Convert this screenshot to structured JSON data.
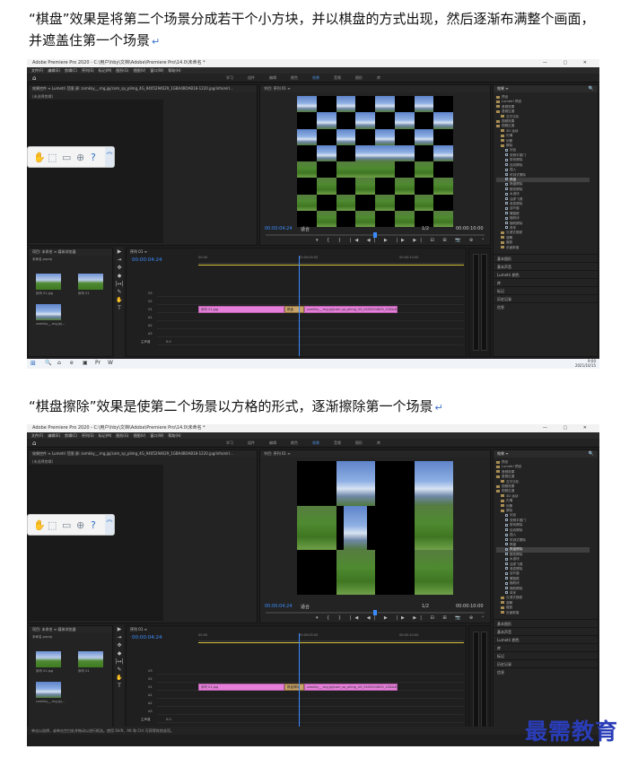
{
  "doc": {
    "para1": "“棋盘”效果是将第二个场景分成若干个小方块，并以棋盘的方式出现，然后逐渐布满整个画面，并遮盖住第一个场景",
    "para2": "“棋盘擦除”效果是使第二个场景以方格的形式，逐渐擦除第一个场景",
    "para_mark": "↵",
    "watermark": "最需教育"
  },
  "app": {
    "window_title": "Adobe Premiere Pro 2020 - C:\\用户\\hby\\文档\\Adobe\\Premiere Pro\\14.0\\未命名 *",
    "window_controls": "— ▢ ✕",
    "home_icon": "⌂",
    "menu": [
      "文件(F)",
      "编辑(E)",
      "剪辑(C)",
      "序列(S)",
      "标记(M)",
      "图形(G)",
      "视图(V)",
      "窗口(W)",
      "帮助(H)"
    ],
    "workspaces": [
      "学习",
      "组件",
      "编辑",
      "颜色",
      "效果",
      "音频",
      "图形",
      "库"
    ],
    "active_workspace": "效果",
    "source_panel": {
      "tabs": "效果控件 ≡   Lumetri 范围   源: zxmkky__.mg,jpj/com_sp_plimg_4G_9405294629_1GBA4BOAB18-1220.jpg/info/e/rl...",
      "no_clip": "(未选择剪辑)"
    },
    "program": {
      "title": "节目: 序列 01 ≡",
      "timecode": "00:00:04:24",
      "fit": "适合",
      "scale": "1/2",
      "duration": "00:00:10:00",
      "controls": "▾ { } |◀ ◀| ▶ |▶ ▶| ⊟ ⊞ 📷 ⊕ ⁺"
    },
    "effects": {
      "title": "效果 ≡",
      "search": "🔍",
      "tree": [
        {
          "label": "预设",
          "type": "fold",
          "indent": 0
        },
        {
          "label": "Lumetri 预设",
          "type": "fold",
          "indent": 0
        },
        {
          "label": "音频效果",
          "type": "fold",
          "indent": 0
        },
        {
          "label": "音频过渡",
          "type": "fold",
          "indent": 0
        },
        {
          "label": "交叉淡化",
          "type": "fold",
          "indent": 1
        },
        {
          "label": "视频效果",
          "type": "fold",
          "indent": 0
        },
        {
          "label": "视频过渡",
          "type": "fold",
          "indent": 0
        },
        {
          "label": "3D 运动",
          "type": "fold",
          "indent": 1
        },
        {
          "label": "内滑",
          "type": "fold",
          "indent": 1
        },
        {
          "label": "划像",
          "type": "fold",
          "indent": 1
        },
        {
          "label": "擦除",
          "type": "fold",
          "indent": 1
        },
        {
          "label": "划出",
          "type": "fx",
          "indent": 2
        },
        {
          "label": "双侧平推门",
          "type": "fx",
          "indent": 2
        },
        {
          "label": "带状擦除",
          "type": "fx",
          "indent": 2
        },
        {
          "label": "径向擦除",
          "type": "fx",
          "indent": 2
        },
        {
          "label": "插入",
          "type": "fx",
          "indent": 2
        },
        {
          "label": "时钟式擦除",
          "type": "fx",
          "indent": 2
        },
        {
          "label": "棋盘",
          "type": "fx",
          "indent": 2,
          "selected_in_shot": 1
        },
        {
          "label": "棋盘擦除",
          "type": "fx",
          "indent": 2,
          "selected_in_shot": 2
        },
        {
          "label": "楔形擦除",
          "type": "fx",
          "indent": 2
        },
        {
          "label": "水波块",
          "type": "fx",
          "indent": 2
        },
        {
          "label": "油漆飞溅",
          "type": "fx",
          "indent": 2
        },
        {
          "label": "渐变擦除",
          "type": "fx",
          "indent": 2
        },
        {
          "label": "百叶窗",
          "type": "fx",
          "indent": 2
        },
        {
          "label": "螺旋框",
          "type": "fx",
          "indent": 2
        },
        {
          "label": "随机块",
          "type": "fx",
          "indent": 2
        },
        {
          "label": "随机擦除",
          "type": "fx",
          "indent": 2
        },
        {
          "label": "风车",
          "type": "fx",
          "indent": 2
        },
        {
          "label": "沉浸式视频",
          "type": "fold",
          "indent": 1
        },
        {
          "label": "溶解",
          "type": "fold",
          "indent": 1
        },
        {
          "label": "缩放",
          "type": "fold",
          "indent": 1
        },
        {
          "label": "页面剥落",
          "type": "fold",
          "indent": 1
        }
      ],
      "lower": [
        "基本图形",
        "基本声音",
        "Lumetri 颜色",
        "库",
        "标记",
        "历史记录",
        "信息"
      ]
    },
    "project": {
      "tabs": "项目: 未命名 ≡   媒体浏览器",
      "file": "未命名.prproj",
      "items": [
        {
          "name": "序列 01.jpg",
          "dur": "5:00"
        },
        {
          "name": "序列 01",
          "dur": "10:00"
        },
        {
          "name": "zxmkky__.mg,jpj...",
          "dur": "5:00"
        }
      ]
    },
    "tools": [
      "▶",
      "⇥",
      "✥",
      "◆",
      "|↔|",
      "✎",
      "✋",
      "T"
    ],
    "timeline": {
      "title": "序列 01 ≡",
      "timecode": "00:00:04:24",
      "ruler": [
        "00:00",
        "00:00:05:00",
        "00:00:10:00"
      ],
      "tracks": [
        "V3",
        "V2",
        "V1",
        "A1",
        "A2",
        "A3",
        "主声道"
      ],
      "master_val": "0.0",
      "clip1": "序列 01.jpg",
      "transition_shot1": "棋盘",
      "transition_shot2": "棋盘擦除",
      "clip2": "zxmkky__.mg,jpj/com_sp_plimg_4G_9405294629_1GBA4BOA..."
    },
    "status_bar": "单击以选择，或单击空白处并拖动以进行框选。使用 Shift、Alt 和 Ctrl 可获得其他选项。",
    "taskbar": {
      "start": "⊞",
      "icons": [
        "🔍",
        "⌂",
        "e",
        "▣",
        "Pr",
        "W"
      ],
      "time": "9:00",
      "date": "2021/10/15"
    },
    "float_toolbar": [
      "✋",
      "⬚",
      "▭",
      "⊕",
      "?"
    ]
  }
}
